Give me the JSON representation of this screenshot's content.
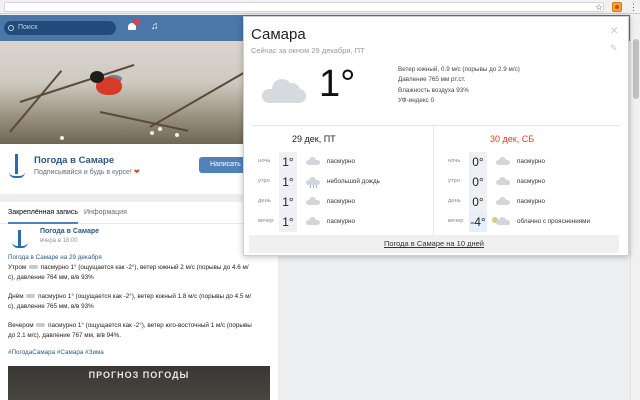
{
  "header": {
    "search_placeholder": "Поиск"
  },
  "group": {
    "title": "Погода в Самаре",
    "subtitle": "Подписывайся и будь в курсе!",
    "write_button": "Написать со",
    "heart": "❤"
  },
  "wall": {
    "tabs": [
      "Закреплённая запись",
      "Информация"
    ],
    "post": {
      "author": "Погода в Самаре",
      "time": "вчера в 18:00",
      "lines": [
        "Погода в Самаре на 29 декабря",
        "Утром",
        "пасмурно 1° (ощущается как -2°), ветер южный 2 м/с (порывы до 4.6 м/",
        "с), давление 764 мм, в/в 93%",
        "Днём",
        "пасмурно 1° (ощущается как -2°), ветер южный 1.8 м/с (порывы до 4.5 м/",
        "с), давление 765 мм, в/в 93%",
        "Вечером",
        "пасмурно 1° (ощущается как -2°), ветер юго-восточный 1 м/с (порывы",
        "до 2.1 м/с), давление 767 мм, в/в 94%.",
        "#ПогодаСамара #Самара #Зима"
      ],
      "image_caption": "ПРОГНОЗ ПОГОДЫ"
    }
  },
  "popup": {
    "city": "Самара",
    "subtitle": "Сейчас за окном 29 декабря, ПТ",
    "now_temp": "1°",
    "details": [
      "Ветер южный, 0.9 м/с (порывы до 2.9 м/с)",
      "Давление 765 мм рт.ст.",
      "Влажность воздуха 93%",
      "УФ-индекс 0"
    ],
    "days": [
      {
        "title": "29 дек, ПТ",
        "weekend": false,
        "rows": [
          {
            "label": "ночь",
            "temp": "1°",
            "cond": "пасмурно",
            "icon": "cloud"
          },
          {
            "label": "утро",
            "temp": "1°",
            "cond": "небольшой дождь",
            "icon": "rain-cloud"
          },
          {
            "label": "день",
            "temp": "1°",
            "cond": "пасмурно",
            "icon": "cloud"
          },
          {
            "label": "вечер",
            "temp": "1°",
            "cond": "пасмурно",
            "icon": "cloud"
          }
        ]
      },
      {
        "title": "30 дек, СБ",
        "weekend": true,
        "rows": [
          {
            "label": "ночь",
            "temp": "0°",
            "cond": "пасмурно",
            "icon": "cloud"
          },
          {
            "label": "утро",
            "temp": "0°",
            "cond": "пасмурно",
            "icon": "cloud"
          },
          {
            "label": "день",
            "temp": "0°",
            "cond": "пасмурно",
            "icon": "cloud"
          },
          {
            "label": "вечер",
            "temp": "-4°",
            "cond": "облачно с прояснениями",
            "icon": "partly-cloudy-night"
          }
        ]
      }
    ],
    "footer_link": "Погода в Самаре на 10 дней"
  },
  "colors": {
    "vk_blue": "#4a76a8",
    "weekend_red": "#e53b2c",
    "link_blue": "#2a5885"
  }
}
